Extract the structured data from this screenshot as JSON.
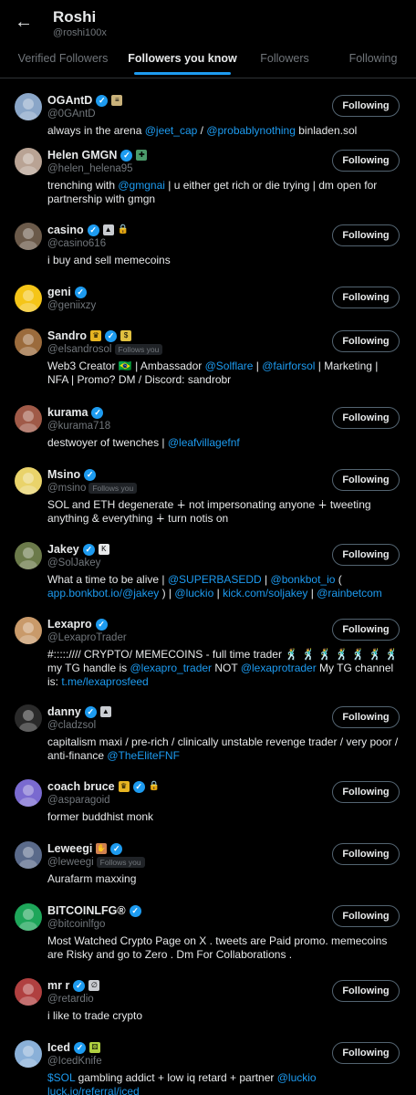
{
  "header": {
    "title": "Roshi",
    "handle": "@roshi100x",
    "back_glyph": "←"
  },
  "tabs": [
    {
      "label": "Verified Followers"
    },
    {
      "label": "Followers you know"
    },
    {
      "label": "Followers"
    },
    {
      "label": "Following"
    }
  ],
  "active_tab": 1,
  "follow_label": "Following",
  "follows_you_label": "Follows you",
  "verified_glyph": "✓",
  "colors": {
    "background": "#000000",
    "accent": "#1d9bf0",
    "muted": "#71767b",
    "text": "#e7e9ea"
  },
  "users": [
    {
      "name": "OGAntD",
      "handle": "@0GAntD",
      "badges": [
        {
          "icon": "square-badge-icon",
          "color": "#c9b27a",
          "glyph": "≡"
        }
      ],
      "follows_you": false,
      "avatar": {
        "icon": "avatar-cartoon-icon",
        "color": "#8aa6c8"
      },
      "bio": [
        {
          "text": "always in the arena "
        },
        {
          "text": "@jeet_cap",
          "link": true
        },
        {
          "text": " / "
        },
        {
          "text": "@probablynothing",
          "link": true
        },
        {
          "text": " binladen.sol"
        }
      ]
    },
    {
      "name": "Helen GMGN",
      "handle": "@helen_helena95",
      "badges": [
        {
          "icon": "gmgn-badge-icon",
          "color": "#4a9a6a",
          "glyph": "✚"
        }
      ],
      "follows_you": false,
      "avatar": {
        "icon": "avatar-photo-icon",
        "color": "#b9a394"
      },
      "bio": [
        {
          "text": "trenching with "
        },
        {
          "text": "@gmgnai",
          "link": true
        },
        {
          "text": " | u either get rich or die trying | dm open for partnership with gmgn"
        }
      ]
    },
    {
      "name": "casino",
      "handle": "@casino616",
      "badges": [
        {
          "icon": "image-badge-icon",
          "color": "#c9ccd1",
          "glyph": "▲"
        },
        {
          "icon": "lock-icon",
          "color": "#e7e9ea",
          "glyph": "🔒"
        }
      ],
      "follows_you": false,
      "avatar": {
        "icon": "avatar-cartoon-icon",
        "color": "#6b5a4a"
      },
      "bio": [
        {
          "text": "i buy and sell memecoins"
        }
      ]
    },
    {
      "name": "geni",
      "handle": "@geniixzy",
      "badges": [],
      "follows_you": false,
      "avatar": {
        "icon": "avatar-yellow-icon",
        "color": "#f5c518"
      },
      "bio": []
    },
    {
      "name": "Sandro",
      "handle": "@elsandrosol",
      "badges": [
        {
          "icon": "crown-icon",
          "color": "#e6b422",
          "glyph": "♛"
        },
        {
          "icon": "square-badge-icon",
          "color": "#e0c040",
          "glyph": "$"
        }
      ],
      "badge_before_verified": true,
      "follows_you": true,
      "avatar": {
        "icon": "avatar-cartoon-icon",
        "color": "#9b6b3c"
      },
      "bio": [
        {
          "text": "Web3 Creator 🇧🇷 | Ambassador "
        },
        {
          "text": "@Solflare",
          "link": true
        },
        {
          "text": " | "
        },
        {
          "text": "@fairforsol",
          "link": true
        },
        {
          "text": " | Marketing | NFA | Promo? DM / Discord: sandrobr"
        }
      ]
    },
    {
      "name": "kurama",
      "handle": "@kurama718",
      "badges": [],
      "follows_you": false,
      "avatar": {
        "icon": "avatar-cartoon-icon",
        "color": "#a05a48"
      },
      "bio": [
        {
          "text": "destwoyer of twenches | "
        },
        {
          "text": "@leafvillagefnf",
          "link": true
        }
      ]
    },
    {
      "name": "Msino",
      "handle": "@msino",
      "badges": [],
      "follows_you": true,
      "avatar": {
        "icon": "avatar-cartoon-icon",
        "color": "#e9d36a"
      },
      "bio": [
        {
          "text": "SOL and ETH degenerate ∔ not impersonating anyone ∔ tweeting anything & everything ∔ turn notis on"
        }
      ]
    },
    {
      "name": "Jakey",
      "handle": "@SolJakey",
      "badges": [
        {
          "icon": "square-badge-icon",
          "color": "#e7e9ea",
          "glyph": "K"
        }
      ],
      "follows_you": false,
      "avatar": {
        "icon": "avatar-cartoon-icon",
        "color": "#6b7a4a"
      },
      "bio": [
        {
          "text": "What a time to be alive | "
        },
        {
          "text": "@SUPERBASEDD",
          "link": true
        },
        {
          "text": " | "
        },
        {
          "text": "@bonkbot_io",
          "link": true
        },
        {
          "text": " ( "
        },
        {
          "text": "app.bonkbot.io/@jakey",
          "link": true
        },
        {
          "text": " ) | "
        },
        {
          "text": "@luckio",
          "link": true
        },
        {
          "text": " | "
        },
        {
          "text": "kick.com/soljakey",
          "link": true
        },
        {
          "text": " | "
        },
        {
          "text": "@rainbetcom",
          "link": true
        }
      ]
    },
    {
      "name": "Lexapro",
      "handle": "@LexaproTrader",
      "badges": [],
      "follows_you": false,
      "avatar": {
        "icon": "avatar-cartoon-icon",
        "color": "#c99a6a"
      },
      "bio": [
        {
          "text": "#:::::////  CRYPTO/ MEMECOINS - full time trader  🕺 🕺 🕺 🕺 🕺 🕺 🕺 my TG handle is "
        },
        {
          "text": "@lexapro_trader",
          "link": true
        },
        {
          "text": " NOT "
        },
        {
          "text": "@lexaprotrader",
          "link": true
        },
        {
          "text": " My TG channel is: "
        },
        {
          "text": "t.me/lexaprosfeed",
          "link": true
        }
      ]
    },
    {
      "name": "danny",
      "handle": "@cladzsol",
      "badges": [
        {
          "icon": "image-badge-icon",
          "color": "#c9ccd1",
          "glyph": "▲"
        }
      ],
      "follows_you": false,
      "avatar": {
        "icon": "avatar-cartoon-icon",
        "color": "#2a2a2a"
      },
      "bio": [
        {
          "text": "capitalism maxi / pre-rich / clinically unstable revenge trader / very poor / anti-finance "
        },
        {
          "text": "@TheEliteFNF",
          "link": true
        }
      ]
    },
    {
      "name": "coach bruce",
      "handle": "@asparagoid",
      "badges": [
        {
          "icon": "crown-icon",
          "color": "#e6b422",
          "glyph": "♛"
        },
        {
          "icon": "lock-icon",
          "color": "#e7e9ea",
          "glyph": "🔒"
        }
      ],
      "badge_before_verified": true,
      "follows_you": false,
      "avatar": {
        "icon": "avatar-cartoon-icon",
        "color": "#7a6ad0"
      },
      "bio": [
        {
          "text": "former buddhist monk"
        }
      ]
    },
    {
      "name": "Leweegi",
      "handle": "@leweegi",
      "badges": [
        {
          "icon": "emoji-badge-icon",
          "color": "#d08050",
          "glyph": "✋"
        }
      ],
      "badge_before_verified": true,
      "follows_you": true,
      "avatar": {
        "icon": "avatar-cartoon-icon",
        "color": "#5a6a8a"
      },
      "bio": [
        {
          "text": "Aurafarm maxxing"
        }
      ]
    },
    {
      "name": "BITCOINLFG®",
      "handle": "@bitcoinlfgo",
      "badges": [],
      "follows_you": false,
      "avatar": {
        "icon": "avatar-logo-icon",
        "color": "#1ea65a"
      },
      "bio": [
        {
          "text": "Most Watched Crypto Page on X . tweets are Paid promo. memecoins are Risky and go to Zero . Dm For Collaborations ."
        }
      ]
    },
    {
      "name": "mr r",
      "handle": "@retardio",
      "badges": [
        {
          "icon": "square-badge-icon",
          "color": "#c9ccd1",
          "glyph": "∅"
        }
      ],
      "follows_you": false,
      "avatar": {
        "icon": "avatar-cartoon-icon",
        "color": "#b04040"
      },
      "bio": [
        {
          "text": "i like to trade crypto"
        }
      ]
    },
    {
      "name": "Iced",
      "handle": "@IcedKnife",
      "badges": [
        {
          "icon": "square-badge-icon",
          "color": "#b0d040",
          "glyph": "⚄"
        }
      ],
      "follows_you": false,
      "avatar": {
        "icon": "avatar-cartoon-icon",
        "color": "#8ab0d8"
      },
      "bio": [
        {
          "text": "$SOL",
          "link": true
        },
        {
          "text": " gambling addict + low iq retard + partner "
        },
        {
          "text": "@luckio",
          "link": true
        },
        {
          "text": " "
        },
        {
          "text": "luck.io/referral/iced",
          "link": true
        }
      ]
    }
  ]
}
